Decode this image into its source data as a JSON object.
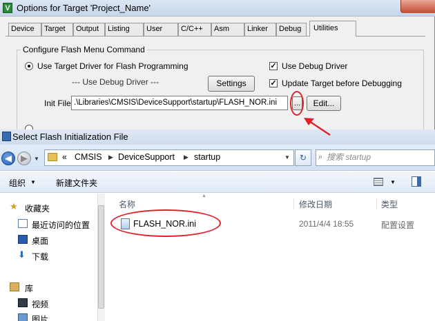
{
  "options_window": {
    "title": "Options for Target 'Project_Name'",
    "app_icon": "V",
    "tabs": [
      {
        "label": "Device"
      },
      {
        "label": "Target"
      },
      {
        "label": "Output"
      },
      {
        "label": "Listing"
      },
      {
        "label": "User"
      },
      {
        "label": "C/C++"
      },
      {
        "label": "Asm"
      },
      {
        "label": "Linker"
      },
      {
        "label": "Debug"
      },
      {
        "label": "Utilities",
        "active": true
      }
    ],
    "group_title": "Configure Flash Menu Command",
    "use_target_driver_label": "Use Target Driver for Flash Programming",
    "use_target_driver_selected": true,
    "use_debug_driver_label": "Use Debug Driver",
    "use_debug_driver_checked": true,
    "debug_driver_placeholder": "--- Use Debug Driver ---",
    "settings_button": "Settings",
    "update_target_label": "Update Target before Debugging",
    "update_target_checked": true,
    "init_file_label": "Init File:",
    "init_file_value": ".\\Libraries\\CMSIS\\DeviceSupport\\startup\\FLASH_NOR.ini",
    "browse_button": "...",
    "edit_button": "Edit..."
  },
  "select_window": {
    "title": "Select Flash Initialization File",
    "breadcrumbs": [
      {
        "label": "«"
      },
      {
        "label": "CMSIS"
      },
      {
        "label": "DeviceSupport"
      },
      {
        "label": "startup"
      }
    ],
    "search_placeholder": "搜索 startup",
    "toolbar": {
      "organize": "组织",
      "new_folder": "新建文件夹"
    },
    "nav_items": [
      {
        "label": "收藏夹",
        "icon": "star-icon"
      },
      {
        "label": "最近访问的位置",
        "icon": "recent-places-icon"
      },
      {
        "label": "桌面",
        "icon": "desktop-icon"
      },
      {
        "label": "下载",
        "icon": "download-icon"
      },
      {
        "label": "库",
        "icon": "library-icon"
      },
      {
        "label": "视频",
        "icon": "video-icon"
      },
      {
        "label": "图片",
        "icon": "picture-icon"
      }
    ],
    "columns": {
      "name": "名称",
      "date": "修改日期",
      "type": "类型"
    },
    "files": [
      {
        "name": "FLASH_NOR.ini",
        "date": "2011/4/4 18:55",
        "type": "配置设置"
      }
    ]
  },
  "annotation_color": "#e0202a"
}
